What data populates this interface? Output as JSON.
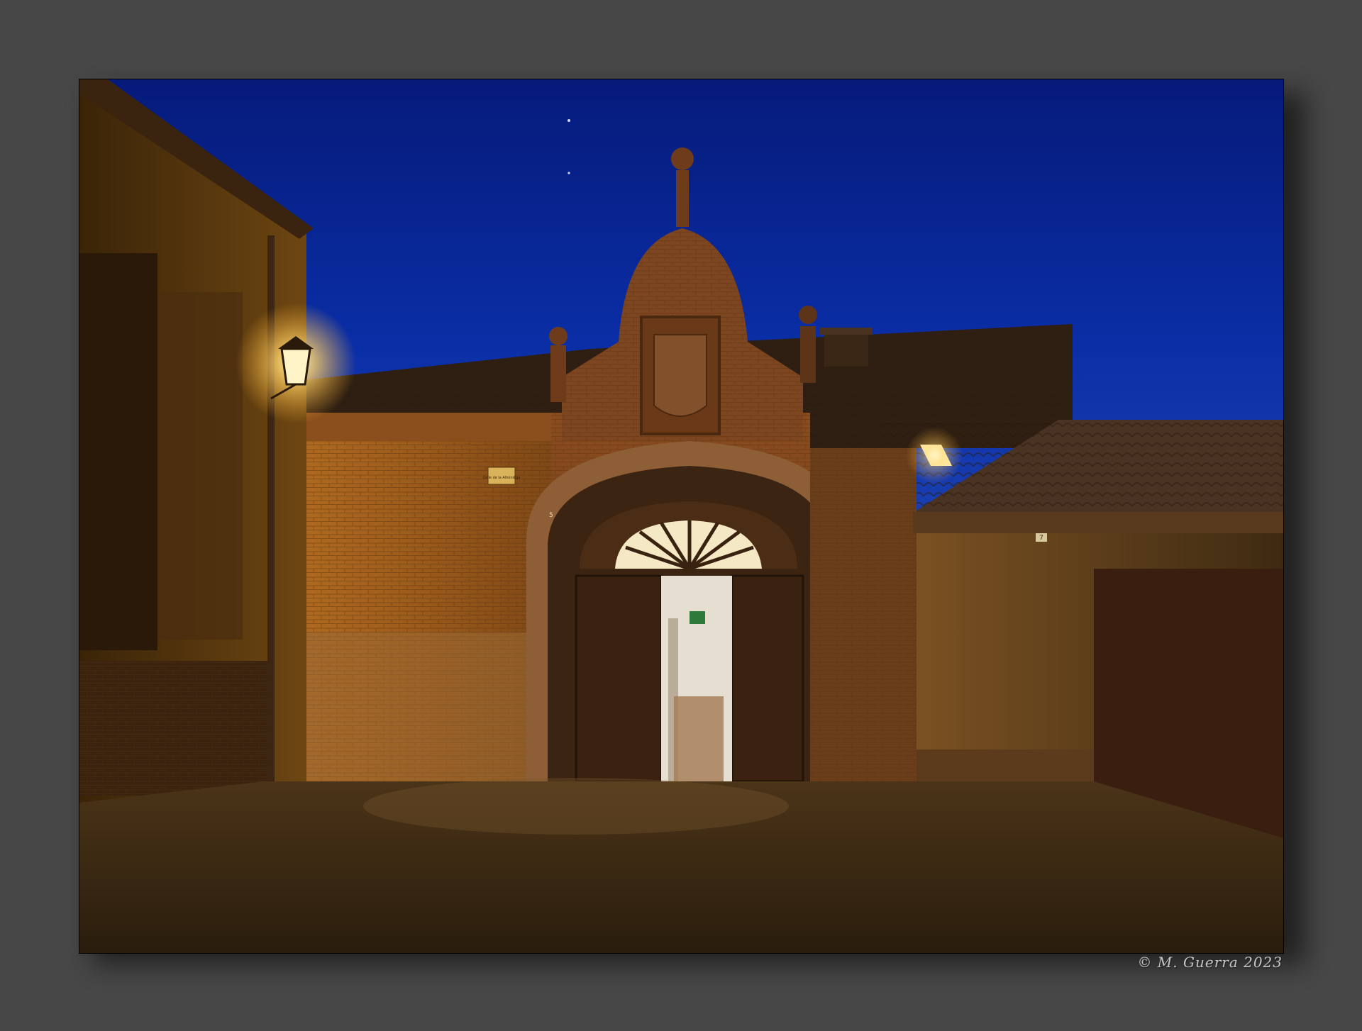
{
  "photo": {
    "street_sign": "Calle de la Alhóndiga",
    "door_number_left": "5",
    "door_number_right": "7"
  },
  "credit": "© M. Guerra 2023"
}
